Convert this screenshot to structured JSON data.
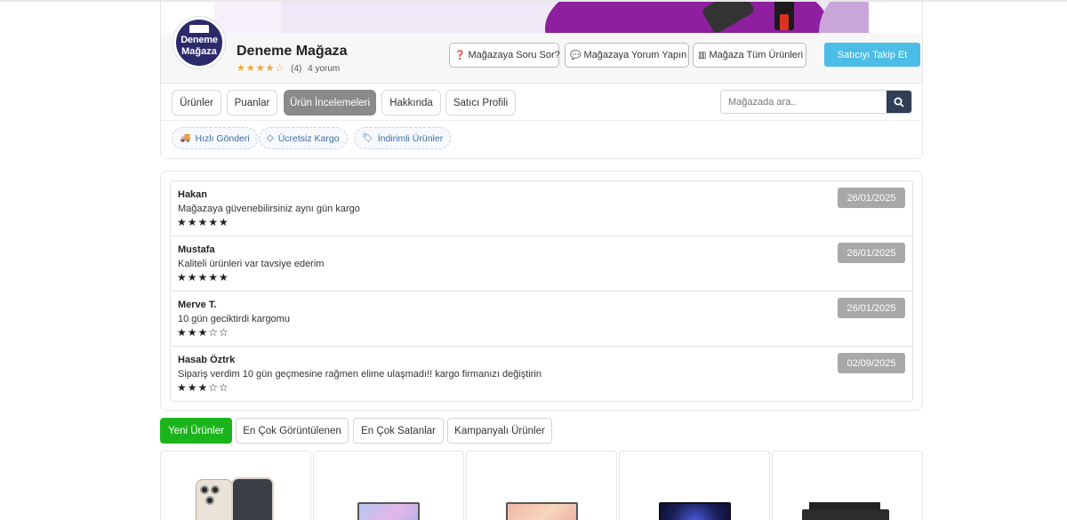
{
  "store": {
    "name": "Deneme Mağaza",
    "logo_line1": "Deneme",
    "logo_line2": "Mağaza",
    "rating_count": "(4)",
    "review_count": "4 yorum",
    "rating_stars": 4,
    "buttons": {
      "ask": "Mağazaya Soru Sor?",
      "comment": "Mağazaya Yorum Yapın",
      "all_products": "Mağaza Tüm Ürünleri",
      "follow": "Satıcıyı Takip Et"
    }
  },
  "tabs": [
    "Ürünler",
    "Puanlar",
    "Ürün İncelemeleri",
    "Hakkında",
    "Satıcı Profili"
  ],
  "active_tab": "Ürün İncelemeleri",
  "search": {
    "placeholder": "Mağazada ara.."
  },
  "chips": [
    "Hızlı Gönderi",
    "Ücretsiz Kargo",
    "İndirimli Ürünler"
  ],
  "reviews": [
    {
      "name": "Hakan",
      "text": "Mağazaya güvenebilirsiniz aynı gün kargo",
      "stars": 5,
      "date": "26/01/2025"
    },
    {
      "name": "Mustafa",
      "text": "Kaliteli ürünleri var tavsiye ederim",
      "stars": 5,
      "date": "26/01/2025"
    },
    {
      "name": "Merve T.",
      "text": "10 gün geciktirdi kargomu",
      "stars": 3,
      "date": "26/01/2025"
    },
    {
      "name": "Hasab Öztrk",
      "text": "Sipariş verdim 10 gün geçmesine rağmen elime ulaşmadı!! kargo firmanızı değiştirin",
      "stars": 3,
      "date": "02/09/2025"
    }
  ],
  "product_tabs": [
    "Yeni Ürünler",
    "En Çok Görüntülenen",
    "En Çok Satanlar",
    "Kampanyalı Ürünler"
  ],
  "active_product_tab": "Yeni Ürünler",
  "colors": {
    "follow_button": "#4bbde6",
    "active_tab": "#8a8a8a",
    "active_product_tab": "#1bb51b",
    "date_badge": "#a8a8a8",
    "rating_star": "#f5a623",
    "chip_text": "#3a6ea8",
    "search_button": "#2f3e55"
  }
}
